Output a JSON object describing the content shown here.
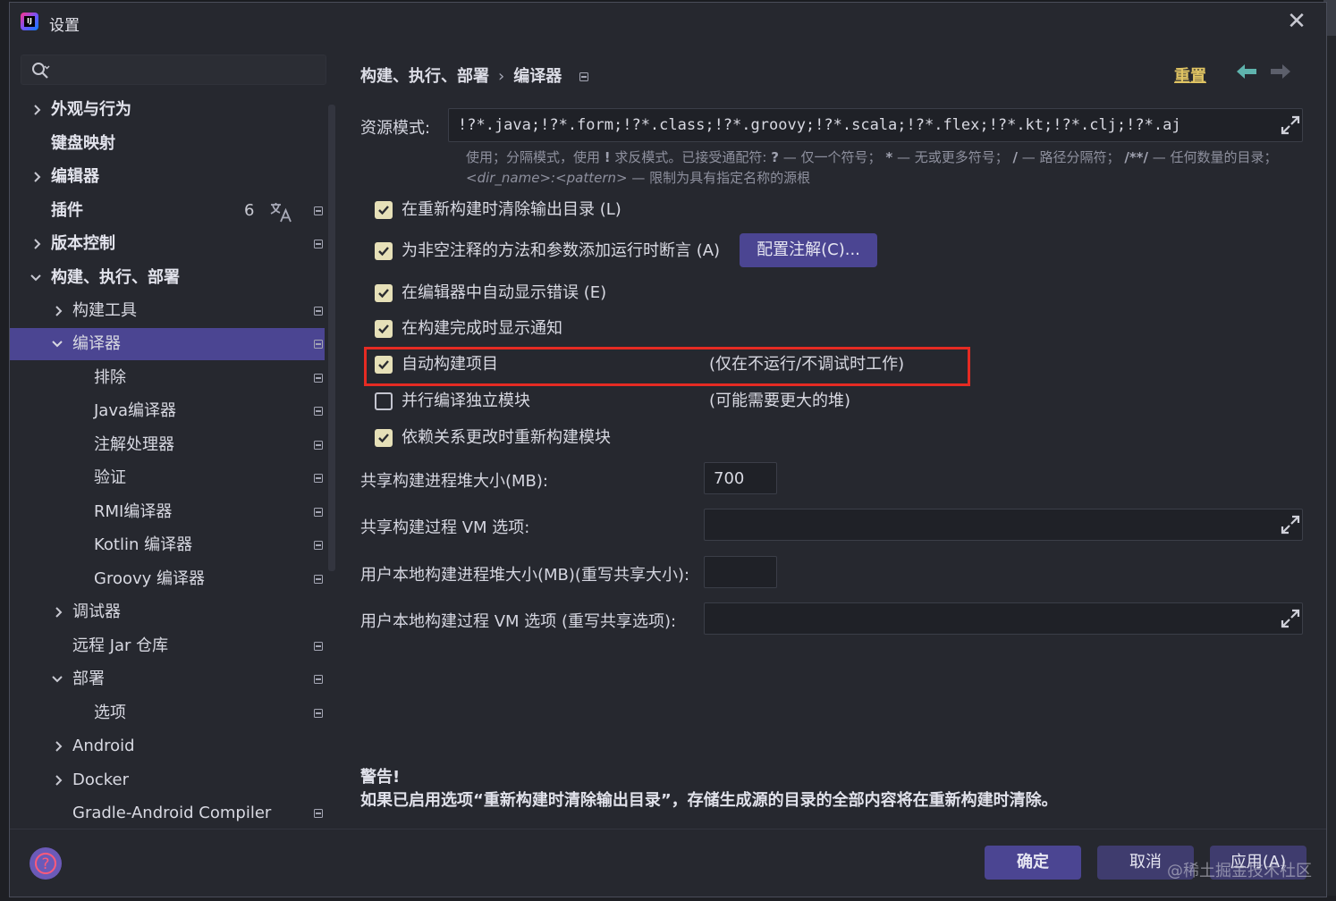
{
  "window": {
    "title": "设置",
    "close_glyph": "✕"
  },
  "sidebar": {
    "search": {
      "placeholder": "",
      "value": ""
    },
    "items": [
      {
        "label": "外观与行为"
      },
      {
        "label": "键盘映射"
      },
      {
        "label": "编辑器"
      },
      {
        "label": "插件",
        "count": "6"
      },
      {
        "label": "版本控制"
      },
      {
        "label": "构建、执行、部署"
      },
      {
        "label": "构建工具"
      },
      {
        "label": "编译器"
      },
      {
        "label": "排除"
      },
      {
        "label": "Java编译器"
      },
      {
        "label": "注解处理器"
      },
      {
        "label": "验证"
      },
      {
        "label": "RMI编译器"
      },
      {
        "label": "Kotlin 编译器"
      },
      {
        "label": "Groovy 编译器"
      },
      {
        "label": "调试器"
      },
      {
        "label": "远程 Jar 仓库"
      },
      {
        "label": "部署"
      },
      {
        "label": "选项"
      },
      {
        "label": "Android"
      },
      {
        "label": "Docker"
      },
      {
        "label": "Gradle-Android Compiler"
      }
    ]
  },
  "header": {
    "breadcrumb": [
      "构建、执行、部署",
      "编译器"
    ],
    "breadcrumb_sep": "›",
    "reset": "重置"
  },
  "main": {
    "resource_patterns": {
      "label": "资源模式:",
      "value": "!?*.java;!?*.form;!?*.class;!?*.groovy;!?*.scala;!?*.flex;!?*.kt;!?*.clj;!?*.aj"
    },
    "hint": {
      "p1": "使用；分隔模式，使用",
      "bang": "!",
      "p2": "求反模式。已接受通配符:",
      "q": "?",
      "p3": "— 仅一个符号；",
      "star": "*",
      "p4": "— 无或更多符号；",
      "slash": "/",
      "p5": "— 路径分隔符；",
      "dstar": "/**/",
      "p6": "— 任何数量的目录；",
      "pattern": "<dir_name>:<pattern>",
      "p7": "— 限制为具有指定名称的源根"
    },
    "checkboxes": [
      {
        "label": "在重新构建时清除输出目录 (L)",
        "checked": true
      },
      {
        "label": "为非空注释的方法和参数添加运行时断言 (A)",
        "checked": true
      },
      {
        "label": "在编辑器中自动显示错误 (E)",
        "checked": true
      },
      {
        "label": "在构建完成时显示通知",
        "checked": true
      },
      {
        "label": "自动构建项目",
        "checked": true,
        "note": "(仅在不运行/不调试时工作)"
      },
      {
        "label": "并行编译独立模块",
        "checked": false,
        "note": "(可能需要更大的堆)"
      },
      {
        "label": "依赖关系更改时重新构建模块",
        "checked": true
      }
    ],
    "config_annotations": "配置注解(C)...",
    "shared_heap": {
      "label": "共享构建进程堆大小(MB):",
      "value": "700"
    },
    "shared_vm": {
      "label": "共享构建过程 VM 选项:",
      "value": ""
    },
    "user_heap": {
      "label": "用户本地构建进程堆大小(MB)(重写共享大小):",
      "value": ""
    },
    "user_vm": {
      "label": "用户本地构建过程 VM 选项 (重写共享选项):",
      "value": ""
    },
    "warning": {
      "title": "警告!",
      "text": "如果已启用选项“重新构建时清除输出目录”，存储生成源的目录的全部内容将在重新构建时清除。"
    }
  },
  "footer": {
    "ok": "确定",
    "cancel": "取消",
    "apply": "应用(A)",
    "watermark": "@稀土掘金技术社区"
  },
  "colors": {
    "accent": "#4b4592",
    "reset_link": "#e0c463",
    "highlight": "#e52b23",
    "checkbox": "#e6e0b8"
  }
}
